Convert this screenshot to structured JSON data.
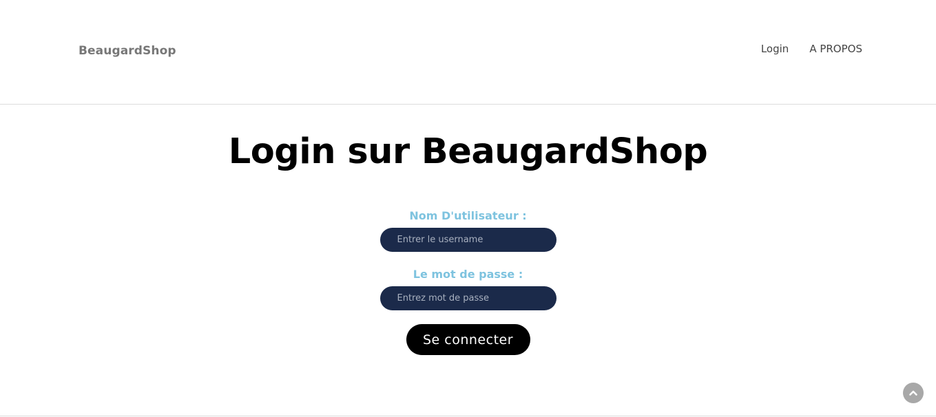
{
  "header": {
    "brand": "BeaugardShop",
    "nav": [
      {
        "label": "Login"
      },
      {
        "label": "A PROPOS"
      }
    ]
  },
  "main": {
    "title": "Login sur BeaugardShop",
    "form": {
      "username_label": "Nom D'utilisateur :",
      "username_placeholder": "Entrer le username",
      "username_value": "",
      "password_label": "Le mot de passe :",
      "password_placeholder": "Entrez mot de passe",
      "password_value": "",
      "submit_label": "Se connecter"
    }
  },
  "scroll_top": {
    "icon": "chevron-up-icon"
  },
  "colors": {
    "label_accent": "#7ec3df",
    "input_bg": "#1b2a4a",
    "button_bg": "#000000"
  }
}
